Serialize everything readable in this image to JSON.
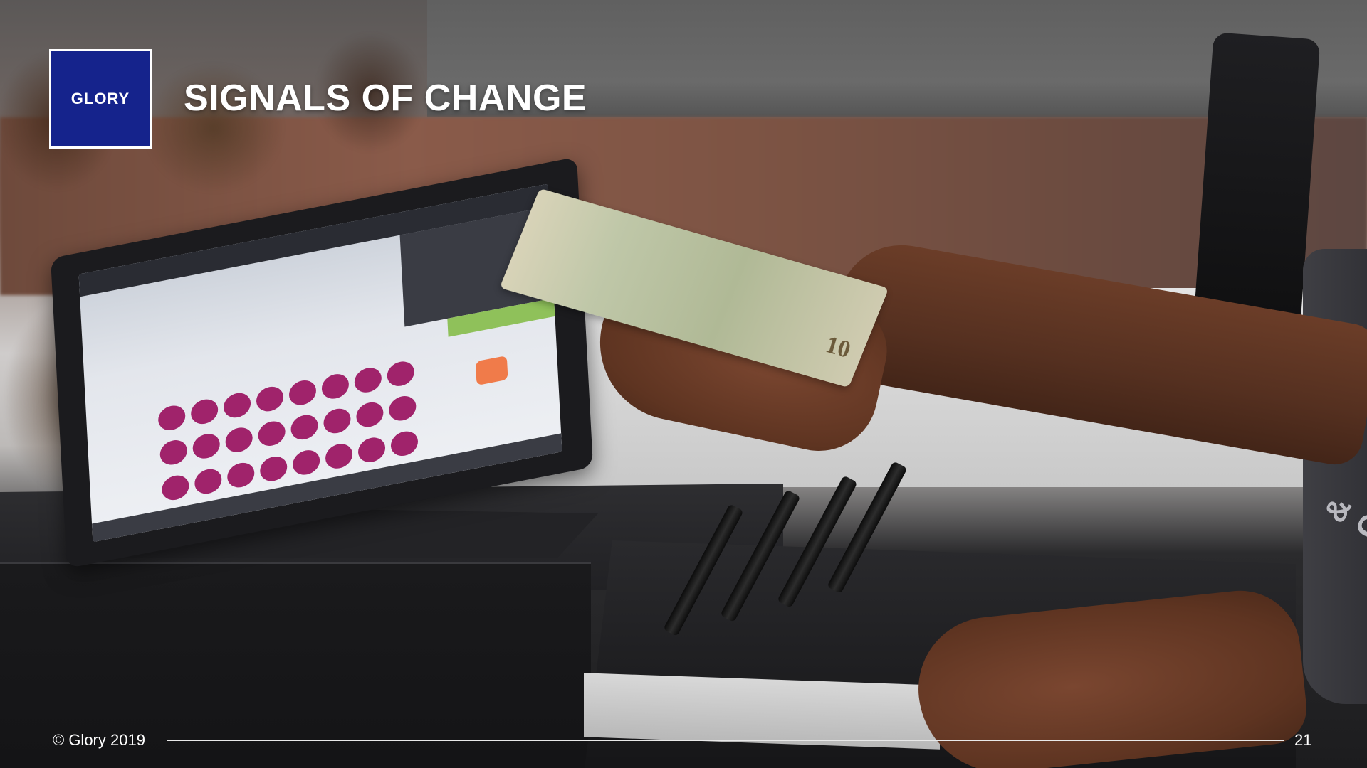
{
  "slide": {
    "logo_text": "GLORY",
    "title": "SIGNALS OF CHANGE",
    "footer_copyright": "© Glory 2019",
    "page_number": "21"
  },
  "photo": {
    "bill_denomination": "10",
    "apron_text": "& CO."
  },
  "colors": {
    "logo_background": "#15238c",
    "title_text": "#ffffff",
    "footer_line": "#e9e9e9"
  }
}
